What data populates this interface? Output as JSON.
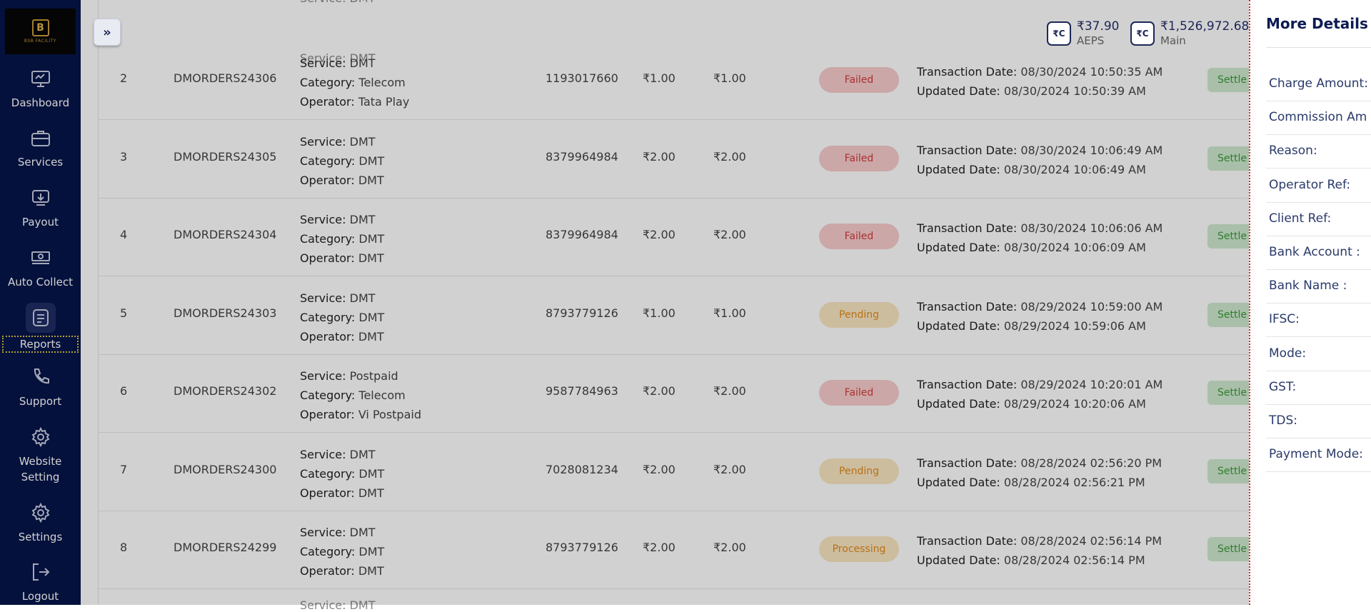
{
  "sidebar": {
    "logo_text": "B",
    "logo_sub": "BSB FACILITY",
    "items": [
      {
        "label": "Dashboard"
      },
      {
        "label": "Services"
      },
      {
        "label": "Payout"
      },
      {
        "label": "Auto Collect"
      },
      {
        "label": "Reports"
      },
      {
        "label": "Support"
      },
      {
        "label": "Website Setting"
      },
      {
        "label": "Settings"
      },
      {
        "label": "Logout"
      }
    ]
  },
  "header": {
    "expand_glyph": "»",
    "wallets": [
      {
        "icon_text": "₹C",
        "amount": "₹37.90",
        "label": "AEPS"
      },
      {
        "icon_text": "₹C",
        "amount": "₹1,526,972.68",
        "label": "Main"
      }
    ]
  },
  "labels": {
    "service": "Service:",
    "category": "Category:",
    "operator": "Operator:",
    "txn_date": "Transaction Date:",
    "upd_date": "Updated Date:"
  },
  "rows": [
    {
      "no": "2",
      "order": "DMORDERS24306",
      "service": "DMT",
      "category": "Telecom",
      "operator": "Tata Play",
      "number": "1193017660",
      "amount": "₹1.00",
      "amount2": "₹1.00",
      "status": "Failed",
      "txn": "08/30/2024 10:50:35 AM",
      "upd": "08/30/2024 10:50:39 AM",
      "settle": "Settle"
    },
    {
      "no": "3",
      "order": "DMORDERS24305",
      "service": "DMT",
      "category": "DMT",
      "operator": "DMT",
      "number": "8379964984",
      "amount": "₹2.00",
      "amount2": "₹2.00",
      "status": "Failed",
      "txn": "08/30/2024 10:06:49 AM",
      "upd": "08/30/2024 10:06:49 AM",
      "settle": "Settle"
    },
    {
      "no": "4",
      "order": "DMORDERS24304",
      "service": "DMT",
      "category": "DMT",
      "operator": "DMT",
      "number": "8379964984",
      "amount": "₹2.00",
      "amount2": "₹2.00",
      "status": "Failed",
      "txn": "08/30/2024 10:06:06 AM",
      "upd": "08/30/2024 10:06:09 AM",
      "settle": "Settle"
    },
    {
      "no": "5",
      "order": "DMORDERS24303",
      "service": "DMT",
      "category": "DMT",
      "operator": "DMT",
      "number": "8793779126",
      "amount": "₹1.00",
      "amount2": "₹1.00",
      "status": "Pending",
      "txn": "08/29/2024 10:59:00 AM",
      "upd": "08/29/2024 10:59:06 AM",
      "settle": "Settle"
    },
    {
      "no": "6",
      "order": "DMORDERS24302",
      "service": "Postpaid",
      "category": "Telecom",
      "operator": "Vi Postpaid",
      "number": "9587784963",
      "amount": "₹2.00",
      "amount2": "₹2.00",
      "status": "Failed",
      "txn": "08/29/2024 10:20:01 AM",
      "upd": "08/29/2024 10:20:06 AM",
      "settle": "Settle"
    },
    {
      "no": "7",
      "order": "DMORDERS24300",
      "service": "DMT",
      "category": "DMT",
      "operator": "DMT",
      "number": "7028081234",
      "amount": "₹2.00",
      "amount2": "₹2.00",
      "status": "Pending",
      "txn": "08/28/2024 02:56:20 PM",
      "upd": "08/28/2024 02:56:21 PM",
      "settle": "Settle"
    },
    {
      "no": "8",
      "order": "DMORDERS24299",
      "service": "DMT",
      "category": "DMT",
      "operator": "DMT",
      "number": "8793779126",
      "amount": "₹2.00",
      "amount2": "₹2.00",
      "status": "Processing",
      "txn": "08/28/2024 02:56:14 PM",
      "upd": "08/28/2024 02:56:14 PM",
      "settle": "Settle"
    }
  ],
  "partial_top": {
    "service": "Service: DMT"
  },
  "partial_bottom": {
    "service": "Service: DMT"
  },
  "drawer": {
    "title": "More Details",
    "fields": [
      "Charge Amount:",
      "Commission Am",
      "Reason:",
      "Operator Ref:",
      "Client Ref:",
      "Bank Account :",
      "Bank Name :",
      "IFSC:",
      "Mode:",
      "GST:",
      "TDS:",
      "Payment Mode:"
    ]
  },
  "colors": {
    "sidebar_bg": "#06154a",
    "failed": "#d23b3b",
    "pending": "#e08a1b",
    "settle": "#3a9a3a",
    "drawer_title": "#0c1b52"
  }
}
